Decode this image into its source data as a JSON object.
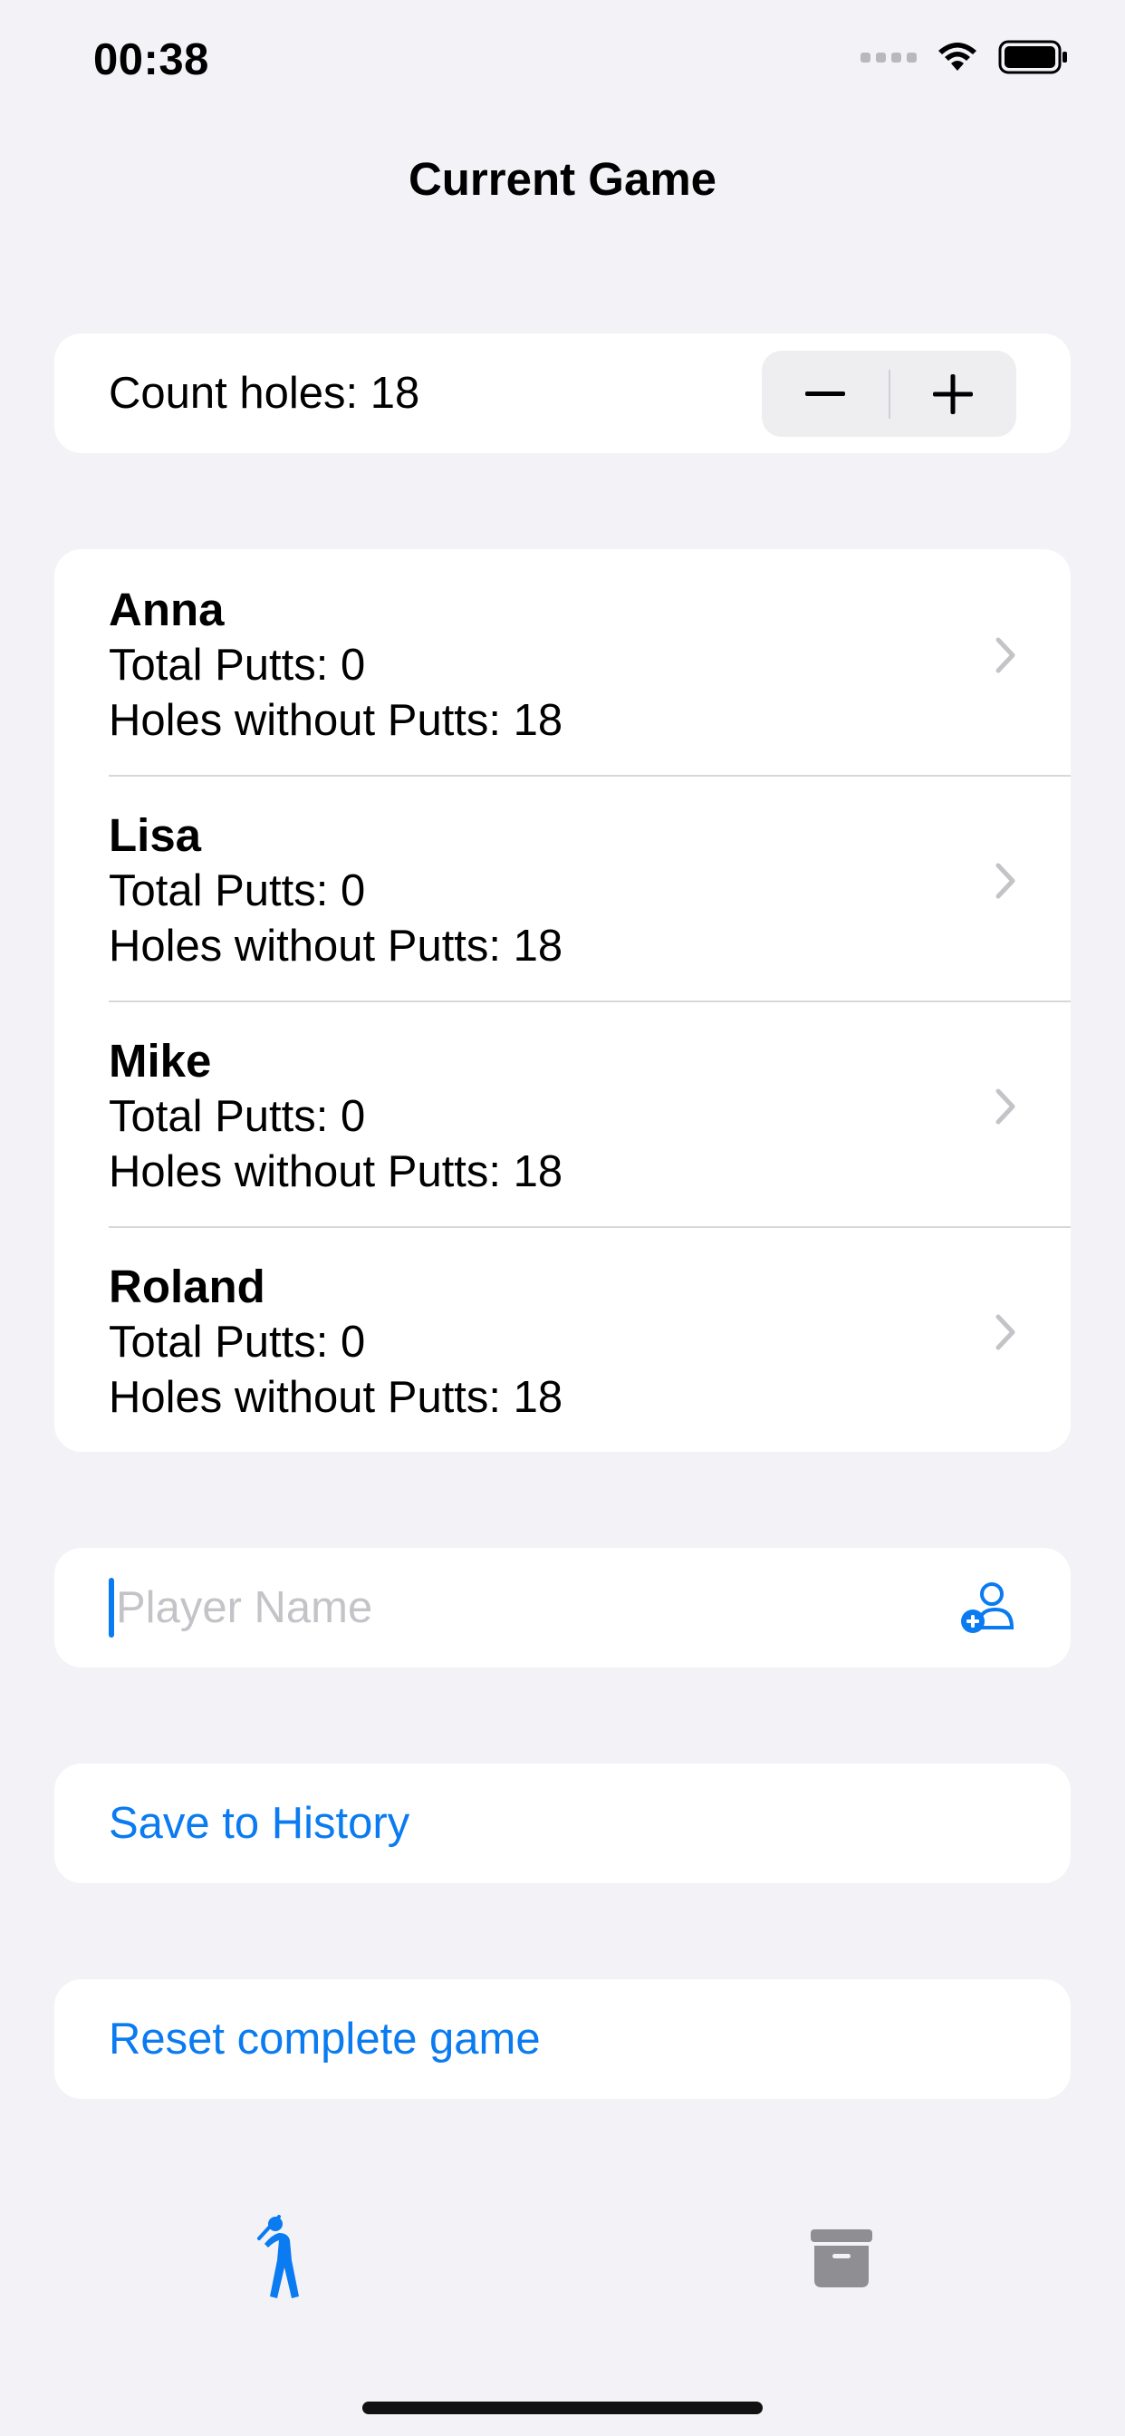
{
  "status_bar": {
    "time": "00:38"
  },
  "nav": {
    "title": "Current Game"
  },
  "holes": {
    "label": "Count holes: 18"
  },
  "players": [
    {
      "name": "Anna",
      "total_putts": "Total Putts: 0",
      "holes_without": "Holes without Putts: 18"
    },
    {
      "name": "Lisa",
      "total_putts": "Total Putts: 0",
      "holes_without": "Holes without Putts: 18"
    },
    {
      "name": "Mike",
      "total_putts": "Total Putts: 0",
      "holes_without": "Holes without Putts: 18"
    },
    {
      "name": "Roland",
      "total_putts": "Total Putts: 0",
      "holes_without": "Holes without Putts: 18"
    }
  ],
  "player_input": {
    "placeholder": "Player Name",
    "value": ""
  },
  "actions": {
    "save_label": "Save to History",
    "reset_label": "Reset complete game"
  },
  "icons": {
    "decrement": "minus-icon",
    "increment": "plus-icon",
    "chevron": "chevron-right-icon",
    "add_player": "person-add-icon",
    "tab_game": "golfer-icon",
    "tab_history": "archive-box-icon"
  },
  "colors": {
    "accent": "#0a7bf0",
    "background": "#f2f2f7",
    "inactive_tab": "#8e8e93"
  }
}
